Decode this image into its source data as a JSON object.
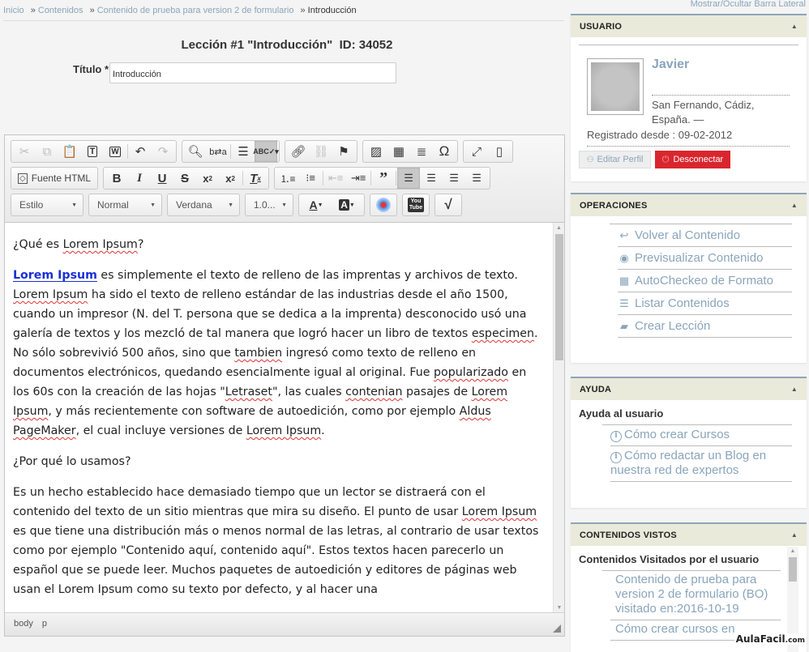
{
  "breadcrumb": {
    "items": [
      {
        "label": "Inicio"
      },
      {
        "label": "Contenidos"
      },
      {
        "label": "Contenido de prueba para version 2 de formulario"
      }
    ],
    "current": "Introducción",
    "separator": "»"
  },
  "page": {
    "title": "Lección #1 \"Introducción\"  ID: 34052",
    "title_field_label": "Título *",
    "title_field_value": "Introducción"
  },
  "editor": {
    "toolbar": {
      "source_button": "Fuente HTML",
      "style_combo": "Estilo",
      "format_combo": "Normal",
      "font_combo": "Verdana",
      "size_combo": "1.0..."
    },
    "content": {
      "heading1": [
        "¿Qué es ",
        "Lorem Ipsum",
        "?"
      ],
      "p1": {
        "link": "Lorem Ipsum",
        "t1": " es simplemente el texto de relleno de las imprentas y archivos de texto. ",
        "s1": "Lorem Ipsum",
        "t2": " ha sido el texto de relleno estándar de las industrias desde el año 1500, cuando un impresor (N. del T. persona que se dedica a la imprenta) desconocido usó una galería de textos y los mezcló de tal manera que logró hacer un libro de textos ",
        "s2": "especimen",
        "t3": ". No sólo sobrevivió 500 años, sino que ",
        "s3": "tambien",
        "t4": " ingresó como texto de relleno en documentos electrónicos, quedando esencialmente igual al original. Fue ",
        "s4": "popularizado",
        "t5": " en los 60s con la creación de las hojas \"",
        "s5": "Letraset",
        "t6": "\", las cuales ",
        "s6": "contenian",
        "t7": " pasajes de ",
        "s7": "Lorem Ipsum",
        "t8": ", y más recientemente con software de autoedición, como por ejemplo ",
        "s8": "Aldus PageMaker",
        "t9": ", el cual incluye versiones de ",
        "s9": "Lorem Ipsum",
        "t10": "."
      },
      "heading2": "¿Por qué lo usamos?",
      "p2": {
        "t1": "Es un hecho establecido hace demasiado tiempo que un lector se distraerá con el contenido del texto de un sitio mientras que mira su diseño. El punto de usar ",
        "s1": "Lorem Ipsum",
        "t2": " es que tiene una distribución más o menos normal de las letras, al contrario de usar textos como por ejemplo \"Contenido aquí, contenido aquí\". Estos textos hacen parecerlo un español que se puede leer. Muchos paquetes de autoedición y editores de páginas web usan el Lorem Ipsum como su texto por defecto, y al hacer una"
      }
    },
    "status_path": [
      "body",
      "p"
    ]
  },
  "sidebar": {
    "toggle_label": "Mostrar/Ocultar Barra Lateral",
    "user_panel": {
      "title": "USUARIO",
      "name": "Javier",
      "location_line1": "San Fernando, Cádiz,",
      "location_line2": "España. —",
      "registered": "Registrado desde : 09-02-2012",
      "edit_button": "Editar Perfil",
      "logout_button": "Desconectar",
      "logout_color": "#d9262e"
    },
    "operations_panel": {
      "title": "OPERACIONES",
      "items": [
        {
          "label": "Volver al Contenido",
          "icon": "reply-icon"
        },
        {
          "label": "Previsualizar Contenido",
          "icon": "eye-icon"
        },
        {
          "label": "AutoCheckeo de Formato",
          "icon": "keyboard-icon"
        },
        {
          "label": "Listar Contenidos",
          "icon": "list-icon"
        },
        {
          "label": "Crear Lección",
          "icon": "folder-plus-icon"
        }
      ]
    },
    "help_panel": {
      "title": "AYUDA",
      "subtitle": "Ayuda al usuario",
      "items": [
        {
          "label": "Cómo crear Cursos"
        },
        {
          "label": "Cómo redactar un Blog en nuestra red de expertos"
        }
      ]
    },
    "seen_panel": {
      "title": "CONTENIDOS VISTOS",
      "subtitle": "Contenidos Visitados por el usuario",
      "items": [
        {
          "label": "Contenido de prueba para version 2 de formulario (BO)",
          "visited": "visitado en:2016-10-19"
        },
        {
          "label": "Cómo crear cursos en",
          "visited": ""
        }
      ]
    }
  },
  "watermark": {
    "brand": "AulaFacil",
    "suffix": ".com"
  },
  "colors": {
    "link": "#8aa5bb",
    "panel_header_bg": "#eaeadb",
    "panel_border": "#8fa4b8",
    "editor_link": "#1a2fd6"
  }
}
